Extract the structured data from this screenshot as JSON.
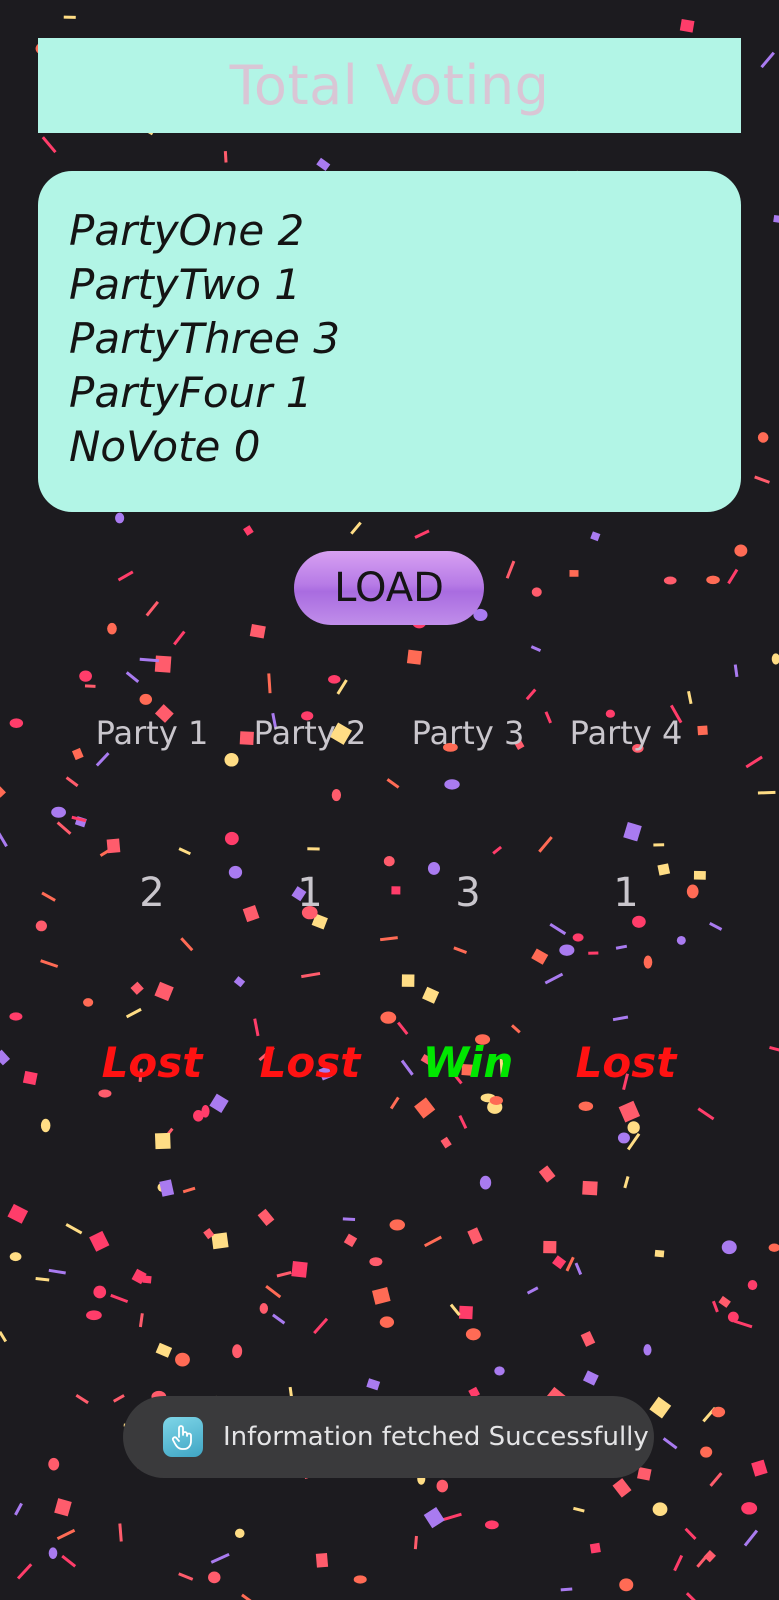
{
  "header": {
    "title": "Total Voting"
  },
  "results": {
    "lines": [
      "PartyOne 2",
      "PartyTwo 1",
      "PartyThree 3",
      "PartyFour 1",
      "NoVote 0"
    ]
  },
  "load_button": {
    "label": "LOAD"
  },
  "parties": [
    {
      "label": "Party 1",
      "count": "2",
      "result": "Lost"
    },
    {
      "label": "Party 2",
      "count": "1",
      "result": "Lost"
    },
    {
      "label": "Party 3",
      "count": "3",
      "result": "Win"
    },
    {
      "label": "Party 4",
      "count": "1",
      "result": "Lost"
    }
  ],
  "toast": {
    "icon": "app-hand-icon",
    "message": "Information fetched Successfully"
  },
  "colors": {
    "background": "#1c1b1f",
    "panel": "#b2f5e6",
    "button": "#b77be6",
    "win": "#00e600",
    "lost": "#ff1212",
    "confetti": [
      "#ff5c6c",
      "#a97bf0",
      "#ffdd85",
      "#ff6b55",
      "#ff3d6a"
    ]
  }
}
